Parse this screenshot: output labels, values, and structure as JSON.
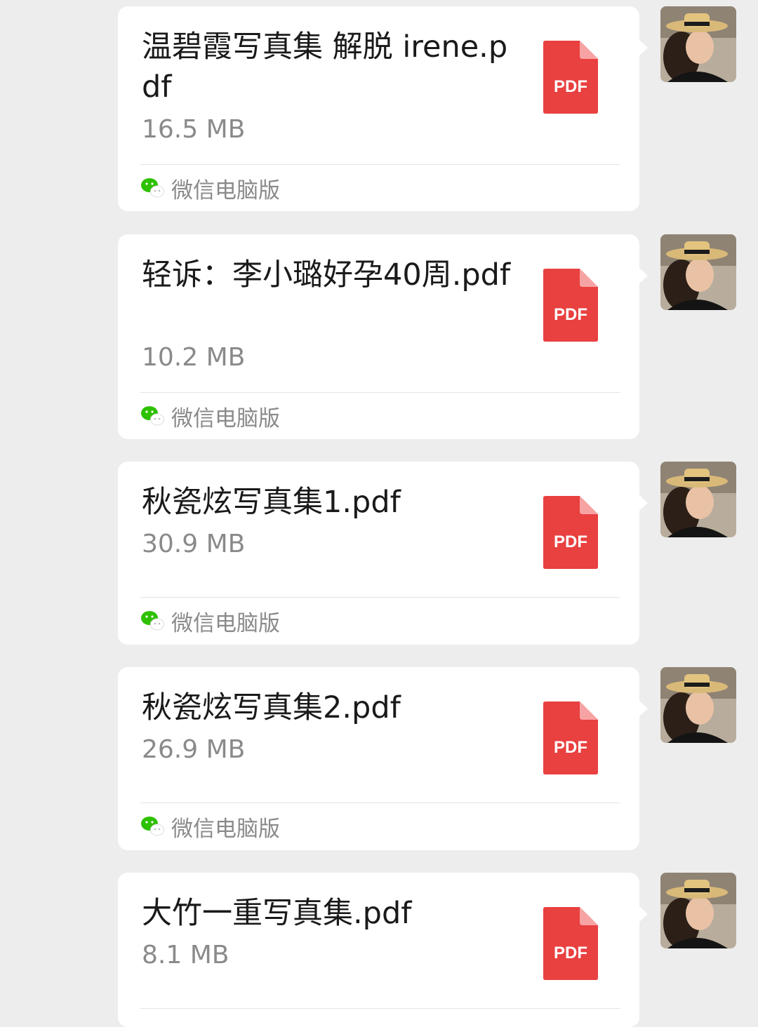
{
  "colors": {
    "background": "#ededed",
    "bubble": "#ffffff",
    "pdf_red": "#e94040",
    "wechat_green": "#2dc100",
    "secondary_text": "#8a8a8a"
  },
  "messages": [
    {
      "filename": "温碧霞写真集 解脱 irene.pdf",
      "size": "16.5 MB",
      "file_badge": "PDF",
      "source_icon": "wechat-icon",
      "source_label": "微信电脑版"
    },
    {
      "filename": "轻诉：李小璐好孕40周.pdf",
      "size": "10.2 MB",
      "file_badge": "PDF",
      "source_icon": "wechat-icon",
      "source_label": "微信电脑版"
    },
    {
      "filename": "秋瓷炫写真集1.pdf",
      "size": "30.9 MB",
      "file_badge": "PDF",
      "source_icon": "wechat-icon",
      "source_label": "微信电脑版"
    },
    {
      "filename": "秋瓷炫写真集2.pdf",
      "size": "26.9 MB",
      "file_badge": "PDF",
      "source_icon": "wechat-icon",
      "source_label": "微信电脑版"
    },
    {
      "filename": "大竹一重写真集.pdf",
      "size": "8.1 MB",
      "file_badge": "PDF",
      "source_icon": "wechat-icon",
      "source_label": ""
    }
  ]
}
